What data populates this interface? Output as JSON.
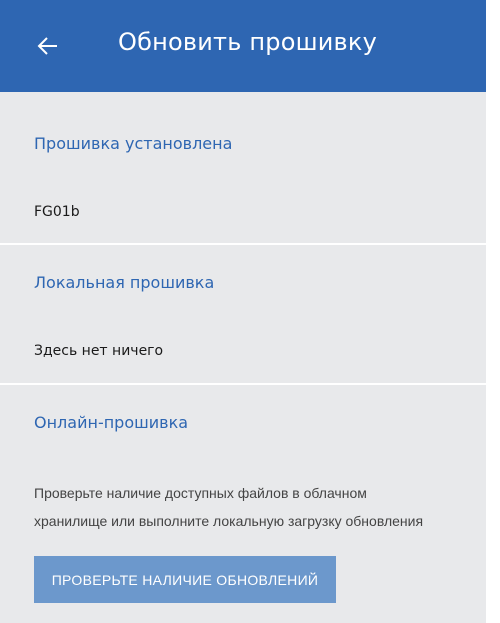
{
  "header": {
    "back_icon": "arrow-left-icon",
    "title": "Обновить прошивку"
  },
  "colors": {
    "app_bar": "#2e66b2",
    "section_title": "#2e66b2",
    "background": "#e8e9eb",
    "button": "#6c98cc"
  },
  "installed": {
    "title": "Прошивка установлена",
    "value": "FG01b"
  },
  "local": {
    "title": "Локальная прошивка",
    "value": "Здесь нет ничего"
  },
  "online": {
    "title": "Онлайн-прошивка",
    "description_line1": "Проверьте наличие доступных файлов в облачном",
    "description_line2": "хранилище или выполните локальную загрузку обновления",
    "button_label": "ПРОВЕРЬТЕ НАЛИЧИЕ ОБНОВЛЕНИЙ"
  }
}
